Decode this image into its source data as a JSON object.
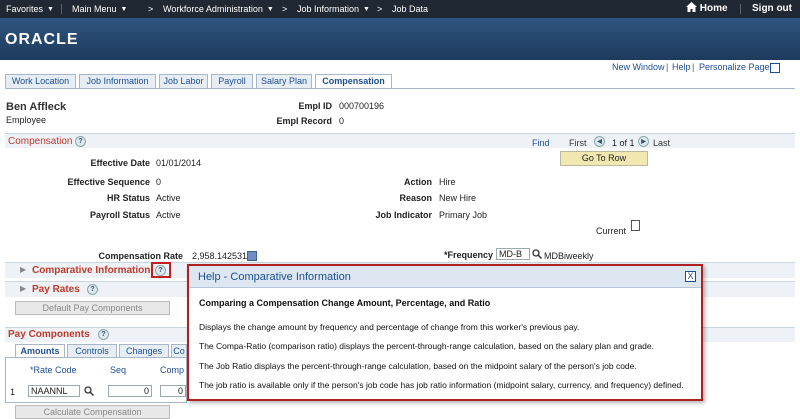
{
  "nav": {
    "favorites": "Favorites",
    "main_menu": "Main Menu",
    "workforce_admin": "Workforce Administration",
    "job_information": "Job Information",
    "job_data": "Job Data",
    "home": "Home",
    "sign_out": "Sign out"
  },
  "brand": {
    "logo": "ORACLE"
  },
  "page_links": {
    "new_window": "New Window",
    "help": "Help",
    "personalize": "Personalize Page"
  },
  "tabs": [
    "Work Location",
    "Job Information",
    "Job Labor",
    "Payroll",
    "Salary Plan",
    "Compensation"
  ],
  "employee": {
    "name": "Ben Affleck",
    "type": "Employee",
    "empl_id_label": "Empl ID",
    "empl_id": "000700196",
    "empl_record_label": "Empl Record",
    "empl_record": "0"
  },
  "compensation": {
    "title": "Compensation",
    "find": "Find",
    "first": "First",
    "of_text": "1 of 1",
    "last": "Last",
    "go_to_row": "Go To Row",
    "effective_date_label": "Effective Date",
    "effective_date": "01/01/2014",
    "effective_sequence_label": "Effective Sequence",
    "effective_sequence": "0",
    "hr_status_label": "HR Status",
    "hr_status": "Active",
    "payroll_status_label": "Payroll Status",
    "payroll_status": "Active",
    "action_label": "Action",
    "action": "Hire",
    "reason_label": "Reason",
    "reason": "New Hire",
    "job_indicator_label": "Job Indicator",
    "job_indicator": "Primary Job",
    "current_label": "Current",
    "comp_rate_label": "Compensation Rate",
    "comp_rate": "2,958.142531",
    "frequency_label": "*Frequency",
    "frequency_value": "MD-B",
    "frequency_desc": "MDBiweekly"
  },
  "comparative": {
    "title": "Comparative Information"
  },
  "pay_rates": {
    "title": "Pay Rates",
    "default_btn": "Default Pay Components"
  },
  "pay_components": {
    "title": "Pay Components",
    "subtabs": [
      "Amounts",
      "Controls",
      "Changes",
      "Co"
    ],
    "col_rate_code": "*Rate Code",
    "col_seq": "Seq",
    "col_comp": "Comp F",
    "row_index": "1",
    "rate_code_value": "NAANNL",
    "seq_value": "0",
    "comp_value": "0",
    "calc_btn": "Calculate Compensation"
  },
  "help_popup": {
    "title": "Help - Comparative Information",
    "close": "X",
    "heading": "Comparing a Compensation Change Amount, Percentage, and Ratio",
    "p1": "Displays the change amount by frequency and percentage of change from this worker's previous pay.",
    "p2": "The Compa-Ratio (comparison ratio) displays the percent-through-range calculation, based on the salary plan and grade.",
    "p3": "The Job Ratio displays the percent-through-range calculation, based on the midpoint salary of the person's job code.",
    "p4": "The job ratio is available only if the person's job code has job ratio information (midpoint salary, currency, and frequency) defined."
  },
  "colors": {
    "accent_red": "#b02020",
    "link_blue": "#1d4f91",
    "topbar": "#1f2833"
  }
}
